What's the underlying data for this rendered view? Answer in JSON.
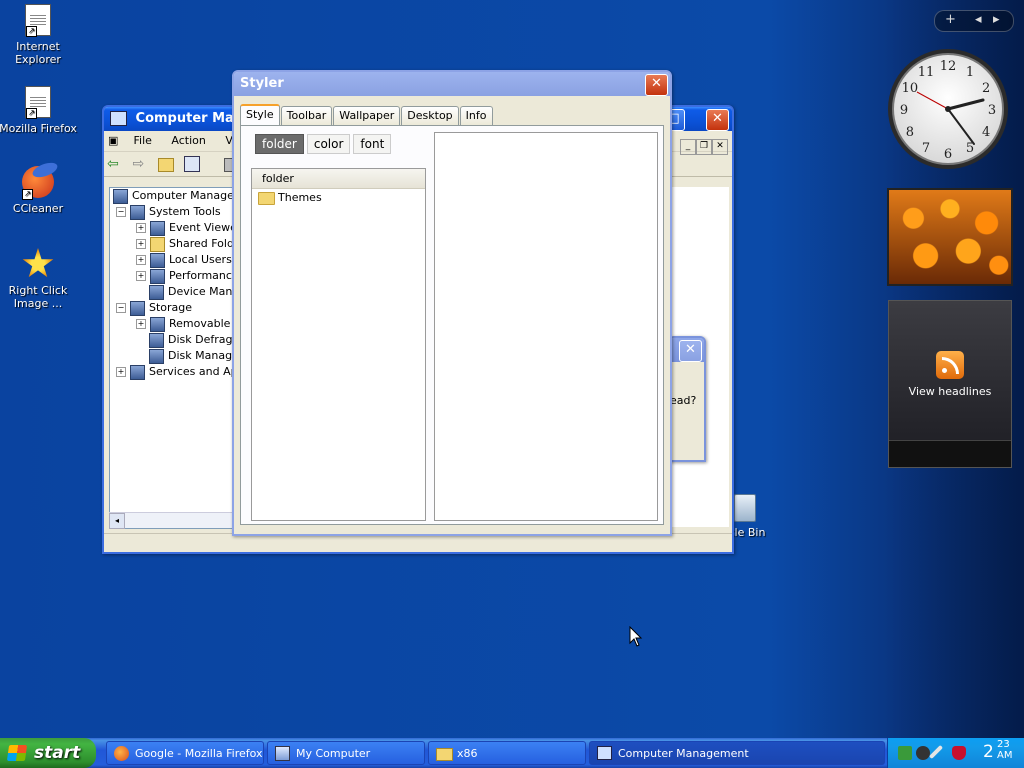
{
  "desktop_icons": [
    {
      "label": "Internet Explorer",
      "icon": "internet-explorer-icon"
    },
    {
      "label": "Mozilla Firefox",
      "icon": "firefox-icon"
    },
    {
      "label": "CCleaner",
      "icon": "ccleaner-icon"
    },
    {
      "label": "Right Click Image ...",
      "icon": "right-click-image-icon"
    }
  ],
  "recycle_bin": {
    "label": "ycle Bin"
  },
  "computer_management": {
    "title": "Computer Manage",
    "menu": [
      "File",
      "Action",
      "View"
    ],
    "tree": [
      {
        "label": "Computer Manageme",
        "level": 0
      },
      {
        "label": "System Tools",
        "level": 1
      },
      {
        "label": "Event Viewer",
        "level": 2
      },
      {
        "label": "Shared Folde",
        "level": 2
      },
      {
        "label": "Local Users a",
        "level": 2
      },
      {
        "label": "Performance",
        "level": 2
      },
      {
        "label": "Device Manag",
        "level": 2
      },
      {
        "label": "Storage",
        "level": 1
      },
      {
        "label": "Removable S",
        "level": 2
      },
      {
        "label": "Disk Defragm",
        "level": 2
      },
      {
        "label": "Disk Manager",
        "level": 2
      },
      {
        "label": "Services and App",
        "level": 1
      }
    ]
  },
  "background_dialog": {
    "fragment_text": "ead?"
  },
  "styler": {
    "title": "Styler",
    "tabs": [
      "Style",
      "Toolbar",
      "Wallpaper",
      "Desktop",
      "Info"
    ],
    "active_tab": "Style",
    "subtabs": [
      "folder",
      "color",
      "font"
    ],
    "active_subtab": "folder",
    "list_header": "folder",
    "list_items": [
      "Themes"
    ]
  },
  "clock": {
    "numbers": [
      "12",
      "1",
      "2",
      "3",
      "4",
      "5",
      "6",
      "7",
      "8",
      "9",
      "10",
      "11"
    ]
  },
  "feeds_gadget": {
    "label": "View headlines"
  },
  "gadget_toolbar": {
    "add": "+",
    "prev": "◂",
    "next": "▸"
  },
  "taskbar": {
    "start_label": "start",
    "tasks": [
      {
        "label": "Google - Mozilla Firefox"
      },
      {
        "label": "My Computer"
      },
      {
        "label": "x86"
      },
      {
        "label": "Computer Management"
      }
    ],
    "clock": {
      "hour": "2",
      "minute": "23",
      "ampm": "AM"
    }
  },
  "colors": {
    "xp_blue": "#0b52d8",
    "start_green": "#43b442",
    "tray_blue": "#139bea"
  }
}
